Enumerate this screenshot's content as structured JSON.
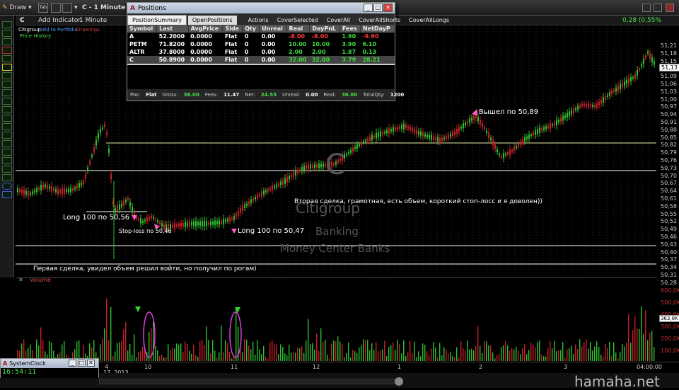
{
  "toolbar": {
    "draw_label": "Draw",
    "tab_label": "Tab",
    "chart_title": "C - 1 Minute"
  },
  "chart_header": {
    "symbol": "C",
    "add_indicator": "Add Indicator",
    "interval": "1 Minute",
    "company": "Citigroup",
    "add_portfolio": "Add to Portfolio",
    "drawings": "Drawings",
    "price_history": "Price History",
    "change": "0,28 (0,55%"
  },
  "positions_window": {
    "title": "Positions",
    "tabs": [
      "PositionSummary",
      "OpenPositions"
    ],
    "actions": [
      "Actions",
      "CoverSelected",
      "CoverAll",
      "CoverAllShorts",
      "CoverAllLongs"
    ],
    "columns": [
      "Symbol",
      "Last",
      "AvgPrice",
      "Side",
      "Qty",
      "Unreal",
      "Real",
      "DayPnL",
      "Fees",
      "NetDayP"
    ],
    "rows": [
      [
        "A",
        "52.2000",
        "0.0000",
        "Flat",
        "0",
        "0.00",
        "-8.00",
        "-8.00",
        "1.90",
        "-9.90"
      ],
      [
        "PETM",
        "71.8200",
        "0.0000",
        "Flat",
        "0",
        "0.00",
        "10.00",
        "10.00",
        "3.90",
        "6.10"
      ],
      [
        "ALTR",
        "37.8000",
        "0.0000",
        "Flat",
        "0",
        "0.00",
        "2.00",
        "2.00",
        "1.87",
        "0.13"
      ],
      [
        "C",
        "50.8900",
        "0.0000",
        "Flat",
        "0",
        "0.00",
        "32.00",
        "32.00",
        "3.79",
        "28.21"
      ]
    ],
    "footer": {
      "pos_label": "Pos:",
      "pos": "Flat",
      "gross_label": "Gross:",
      "gross": "36.00",
      "fees_label": "Fees:",
      "fees": "11.47",
      "net_label": "Net:",
      "net": "24.53",
      "unreal_label": "Unreal:",
      "unreal": "0.00",
      "real_label": "Real:",
      "real": "36.00",
      "totalqty_label": "TotalQty:",
      "totalqty": "1200"
    }
  },
  "clock_window": {
    "title": "SystemClock",
    "time": "16:54:11"
  },
  "annotations": {
    "long1": "Long 100 по 50,56",
    "stoploss": "Stop-loss по 50,46",
    "long2": "Long 100 по 50,47",
    "exit": "Вышел по 50,89",
    "second_trade": "Вторая сделка, грамотная, есть объем, короткий стоп-лосс и я доволен))",
    "first_trade": "Первая сделка, увидел объем решил войти, но получил по рогам)"
  },
  "watermark": {
    "symbol": "C",
    "name": "Citigroup",
    "sector": "Banking",
    "industry": "Money Center Banks"
  },
  "price_axis": {
    "labels": [
      "51,21",
      "51,18",
      "51,15",
      "51,12",
      "51,09",
      "51,06",
      "51,03",
      "51,00",
      "50,97",
      "50,94",
      "50,91",
      "50,88",
      "50,85",
      "50,82",
      "50,79",
      "50,76",
      "50,73",
      "50,70",
      "50,67",
      "50,64",
      "50,61",
      "50,58",
      "50,55",
      "50,52",
      "50,49",
      "50,46",
      "50,43",
      "50,40",
      "50,37",
      "50,34",
      "50,31",
      "50,28"
    ],
    "current": "51,13"
  },
  "volume_panel": {
    "title": "Volume",
    "axis_labels": [
      "600,0K",
      "500,0K",
      "400,0K",
      "300,0K",
      "200,0K",
      "100,0K"
    ],
    "current": "363,8K"
  },
  "time_axis": {
    "labels": [
      "4",
      "10",
      "11",
      "12",
      "1",
      "2",
      "3",
      "04:00:00"
    ],
    "date": "17, 2013"
  },
  "site_watermark": "hamaha.net",
  "colors": {
    "up": "#2fbf2f",
    "down": "#c8202a",
    "accent": "#2f7fd8"
  }
}
